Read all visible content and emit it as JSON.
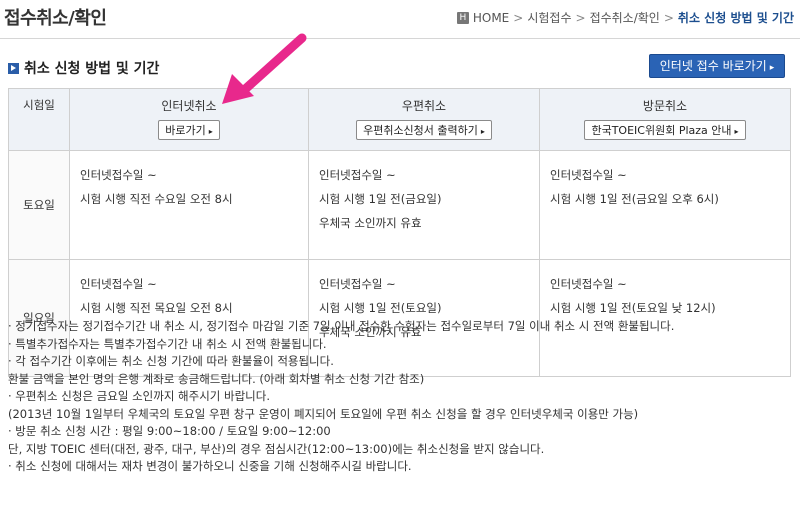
{
  "header": {
    "title": "접수취소/확인",
    "breadcrumb": [
      "HOME",
      "시험접수",
      "접수취소/확인",
      "취소 신청 방법 및 기간"
    ]
  },
  "section": {
    "title": "취소 신청 방법 및 기간",
    "go_button": "인터넷 접수 바로가기"
  },
  "table": {
    "day_header": "시험일",
    "columns": [
      {
        "title": "인터넷취소",
        "button": "바로가기"
      },
      {
        "title": "우편취소",
        "button": "우편취소신청서 출력하기"
      },
      {
        "title": "방문취소",
        "button": "한국TOEIC위원회 Plaza 안내"
      }
    ],
    "rows": [
      {
        "day": "토요일",
        "cells": [
          [
            "인터넷접수일 ~",
            "시험 시행 직전 수요일 오전 8시"
          ],
          [
            "인터넷접수일 ~",
            "시험 시행 1일 전(금요일)",
            "우체국 소인까지 유효"
          ],
          [
            "인터넷접수일 ~",
            "시험 시행 1일 전(금요일 오후 6시)"
          ]
        ]
      },
      {
        "day": "일요일",
        "cells": [
          [
            "인터넷접수일 ~",
            "시험 시행 직전 목요일 오전 8시"
          ],
          [
            "인터넷접수일 ~",
            "시험 시행 1일 전(토요일)",
            "우체국 소인까지 유효"
          ],
          [
            "인터넷접수일 ~",
            "시험 시행 1일 전(토요일 낮 12시)"
          ]
        ]
      }
    ]
  },
  "notes": [
    "· 정기접수자는 정기접수기간 내 취소 시, 정기접수 마감일 기준 7일 이내 접수한 수험자는 접수일로부터 7일 이내 취소 시 전액 환불됩니다.",
    "· 특별추가접수자는 특별추가접수기간 내 취소 시 전액 환불됩니다.",
    "· 각 접수기간 이후에는 취소 신청 기간에 따라 환불율이 적용됩니다.",
    "  환불 금액을 본인 명의 은행 계좌로 송금해드립니다. (아래 회차별 취소 신청 기간 참조)",
    "· 우편취소 신청은 금요일 소인까지 해주시기 바랍니다.",
    "  (2013년 10월 1일부터 우체국의 토요일 우편 창구 운영이 폐지되어 토요일에 우편 취소 신청을 할 경우 인터넷우체국 이용만 가능)",
    "· 방문 취소 신청 시간 : 평일 9:00~18:00 / 토요일 9:00~12:00",
    "  단, 지방 TOEIC 센터(대전, 광주, 대구, 부산)의 경우 점심시간(12:00~13:00)에는 취소신청을 받지 않습니다.",
    "· 취소 신청에 대해서는 재차 변경이 불가하오니 신중을 기해 신청해주시길 바랍니다."
  ],
  "colors": {
    "accent": "#2a63b5",
    "arrow": "#e8288c"
  }
}
